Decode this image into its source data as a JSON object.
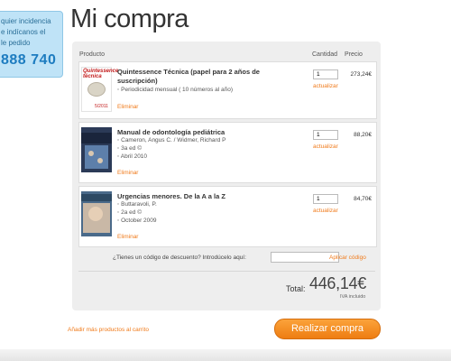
{
  "help_box": {
    "line_1": "quier incidencia",
    "line_2": "e indícanos el",
    "line_3": "le pedido",
    "phone": "888 740"
  },
  "page": {
    "title": "Mi compra"
  },
  "cart": {
    "columns": {
      "product": "Producto",
      "quantity": "Cantidad",
      "price": "Precio"
    },
    "update_label": "actualizar",
    "remove_label": "Eliminar",
    "items": [
      {
        "title": "Quintessence Técnica (papel para 2 años de suscripción)",
        "details": [
          "Periodicidad mensual ( 10 números al año)"
        ],
        "quantity": "1",
        "price": "273,24€",
        "cover_text": {
          "title": "Quintessence técnica",
          "date": "5/2011"
        }
      },
      {
        "title": "Manual de odontología pediátrica",
        "details": [
          "Cameron, Angus C. / Widmer, Richard P",
          "3a ed ©",
          "Abril 2010"
        ],
        "quantity": "1",
        "price": "88,20€"
      },
      {
        "title": "Urgencias menores. De la A a la Z",
        "details": [
          "Buttaravoli, P.",
          "2a ed ©",
          "October 2009"
        ],
        "quantity": "1",
        "price": "84,70€"
      }
    ],
    "discount": {
      "label": "¿Tienes un código de descuento? Introdúcelo aquí:",
      "value": "",
      "apply_label": "Aplicar código"
    },
    "total": {
      "label": "Total:",
      "amount": "446,14€",
      "vat_note": "IVA incluido"
    }
  },
  "actions": {
    "add_more_label": "Añadir más productos al carrito",
    "checkout_label": "Realizar compra"
  },
  "colors": {
    "accent": "#f07a1a",
    "button_orange": "#f39a2a",
    "help_blue": "#bfe3f7",
    "panel_gray": "#eeeeee"
  }
}
